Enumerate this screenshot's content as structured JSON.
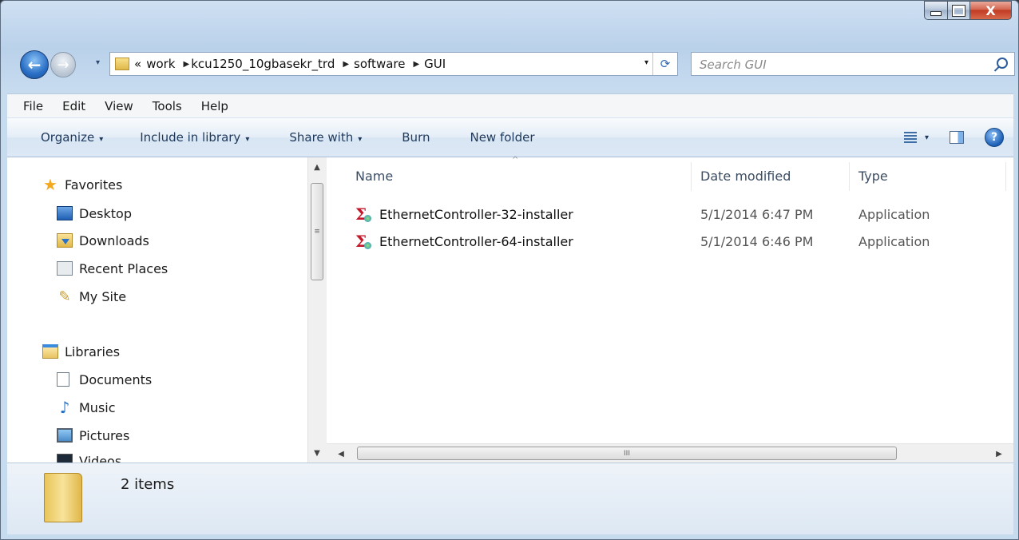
{
  "window": {
    "caption_buttons": {
      "close_glyph": "X"
    }
  },
  "nav_buttons": {
    "back_glyph": "←",
    "forward_glyph": "→",
    "history_glyph": "▾"
  },
  "address": {
    "overflow": "«",
    "crumbs": [
      "work",
      "kcu1250_10gbasekr_trd",
      "software",
      "GUI"
    ],
    "dropdown_glyph": "▾",
    "refresh_glyph": "⟳"
  },
  "search": {
    "placeholder": "Search GUI"
  },
  "menu": [
    "File",
    "Edit",
    "View",
    "Tools",
    "Help"
  ],
  "toolbar": {
    "organize": "Organize",
    "include_in_library": "Include in library",
    "share_with": "Share with",
    "burn": "Burn",
    "new_folder": "New folder",
    "dropdown_glyph": "▾",
    "help_glyph": "?"
  },
  "sidebar": {
    "favorites": {
      "label": "Favorites",
      "icon": "star-icon",
      "items": [
        {
          "label": "Desktop",
          "icon": "desktop-icon"
        },
        {
          "label": "Downloads",
          "icon": "downloads-icon"
        },
        {
          "label": "Recent Places",
          "icon": "recent-places-icon"
        },
        {
          "label": "My Site",
          "icon": "my-site-icon"
        }
      ]
    },
    "libraries": {
      "label": "Libraries",
      "icon": "libraries-icon",
      "items": [
        {
          "label": "Documents",
          "icon": "documents-icon"
        },
        {
          "label": "Music",
          "icon": "music-icon"
        },
        {
          "label": "Pictures",
          "icon": "pictures-icon"
        },
        {
          "label": "Videos",
          "icon": "videos-icon"
        }
      ]
    }
  },
  "file_list": {
    "columns": {
      "name": "Name",
      "date": "Date modified",
      "type": "Type"
    },
    "sort_glyph": "^",
    "rows": [
      {
        "name": "EthernetController-32-installer",
        "date": "5/1/2014 6:47 PM",
        "type": "Application"
      },
      {
        "name": "EthernetController-64-installer",
        "date": "5/1/2014 6:46 PM",
        "type": "Application"
      }
    ]
  },
  "scrollbars": {
    "up": "▲",
    "down": "▼",
    "left": "◀",
    "right": "▶",
    "grip_v": "≡",
    "grip_h": "III"
  },
  "details": {
    "item_count": "2 items"
  }
}
